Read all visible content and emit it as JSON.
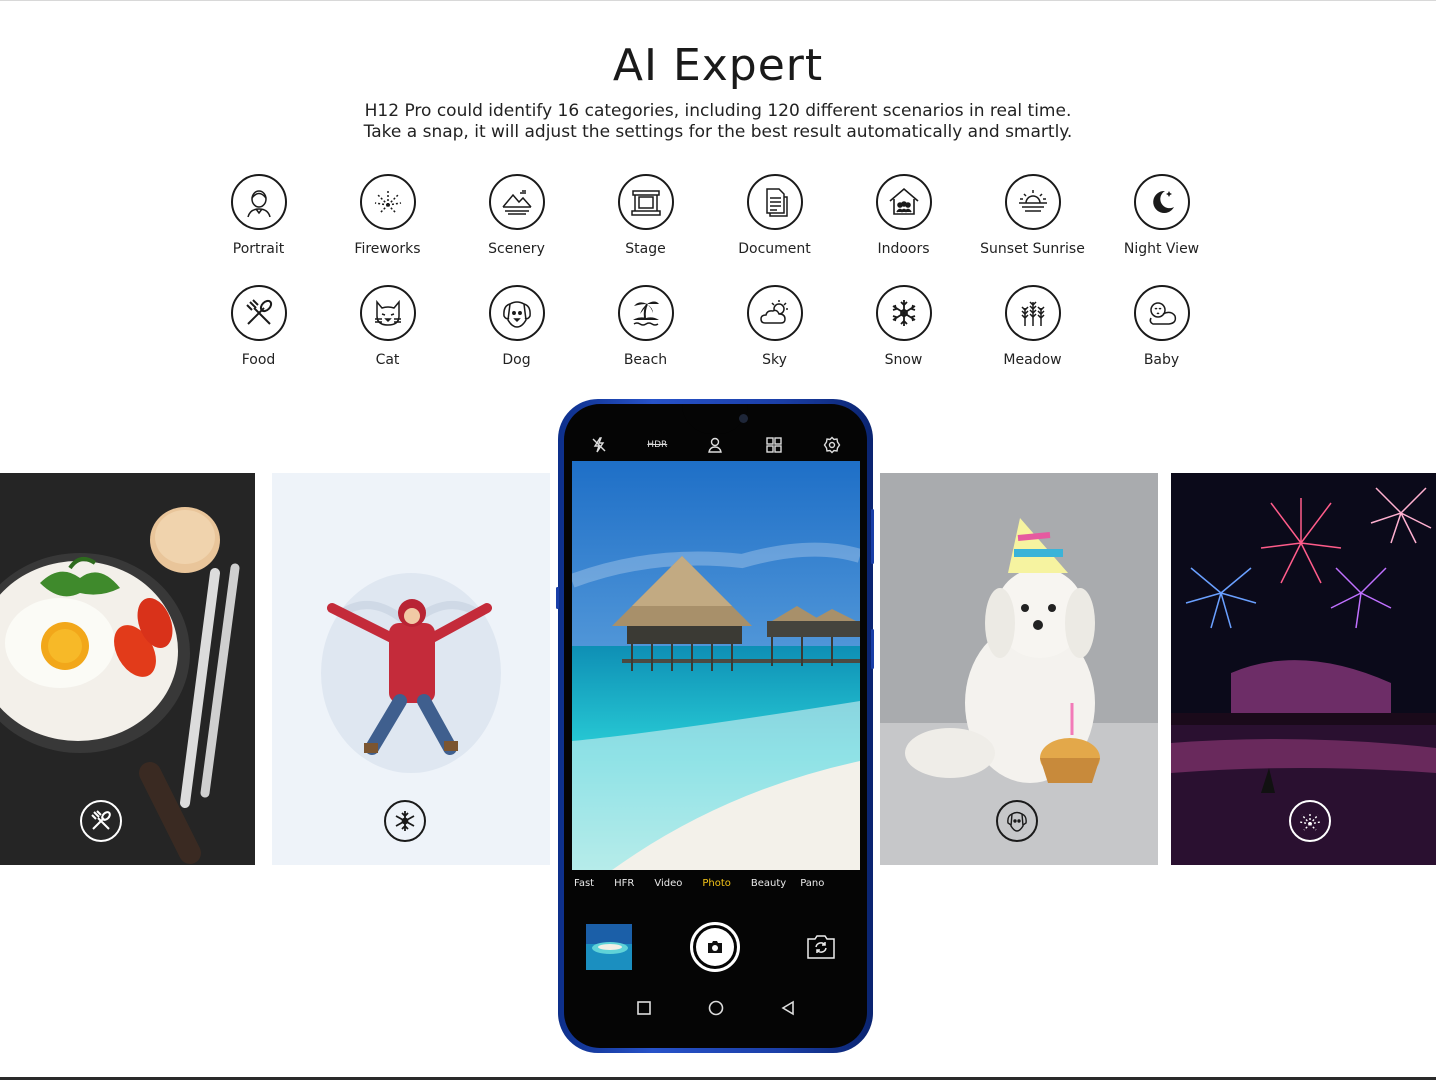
{
  "page": {
    "title": "AI Expert",
    "subtitle_line1": "H12 Pro could identify 16 categories, including 120 different scenarios in real time.",
    "subtitle_line2": "Take a snap, it will adjust the settings for the best result automatically and smartly."
  },
  "categories_row1": [
    {
      "label": "Portrait",
      "icon": "portrait-icon"
    },
    {
      "label": "Fireworks",
      "icon": "fireworks-icon"
    },
    {
      "label": "Scenery",
      "icon": "scenery-icon"
    },
    {
      "label": "Stage",
      "icon": "stage-icon"
    },
    {
      "label": "Document",
      "icon": "document-icon"
    },
    {
      "label": "Indoors",
      "icon": "indoors-icon"
    },
    {
      "label": "Sunset Sunrise",
      "icon": "sunset-icon"
    },
    {
      "label": "Night View",
      "icon": "night-view-icon"
    }
  ],
  "categories_row2": [
    {
      "label": "Food",
      "icon": "food-icon"
    },
    {
      "label": "Cat",
      "icon": "cat-icon"
    },
    {
      "label": "Dog",
      "icon": "dog-icon"
    },
    {
      "label": "Beach",
      "icon": "beach-icon"
    },
    {
      "label": "Sky",
      "icon": "sky-icon"
    },
    {
      "label": "Snow",
      "icon": "snow-icon"
    },
    {
      "label": "Meadow",
      "icon": "meadow-icon"
    },
    {
      "label": "Baby",
      "icon": "baby-icon"
    }
  ],
  "camera": {
    "toolbar": {
      "hdr": "HDR"
    },
    "modes": [
      "Fast",
      "HFR",
      "Video",
      "Photo",
      "Beauty",
      "Pano"
    ],
    "active_mode": "Photo",
    "accent_color": "#f5c518"
  },
  "colors": {
    "phone_frame": "#1b3fa8"
  }
}
